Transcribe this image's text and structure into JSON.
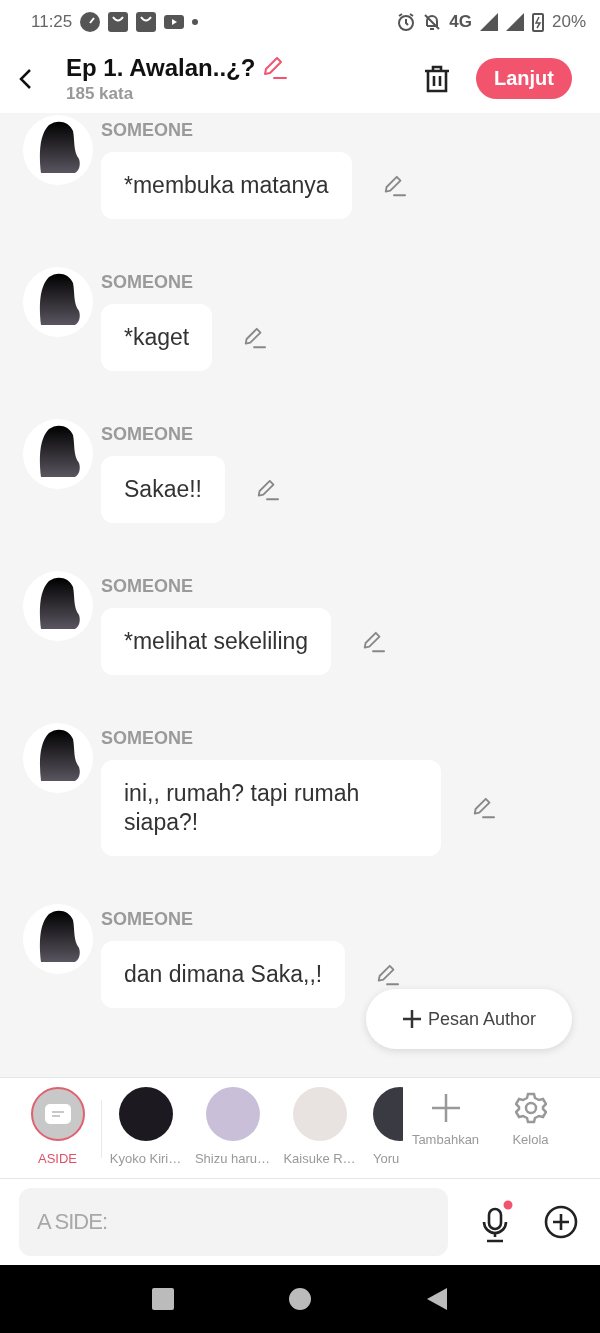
{
  "status_bar": {
    "time": "11:25",
    "network": "4G",
    "battery": "20%"
  },
  "header": {
    "title": "Ep 1. Awalan..¿?",
    "subtitle": "185 kata",
    "next_button": "Lanjut"
  },
  "messages": [
    {
      "speaker": "SOMEONE",
      "text": "*membuka matanya"
    },
    {
      "speaker": "SOMEONE",
      "text": "*kaget"
    },
    {
      "speaker": "SOMEONE",
      "text": "Sakae!!"
    },
    {
      "speaker": "SOMEONE",
      "text": "*melihat sekeliling"
    },
    {
      "speaker": "SOMEONE",
      "text": "ini,, rumah? tapi rumah siapa?!"
    },
    {
      "speaker": "SOMEONE",
      "text": "dan dimana Saka,,!"
    }
  ],
  "author_button": {
    "label": "Pesan Author"
  },
  "cast": {
    "characters": [
      {
        "kind": "aside",
        "label": "ASIDE",
        "selected": true
      },
      {
        "kind": "character",
        "label": "Kyoko Kiri…",
        "selected": false
      },
      {
        "kind": "character",
        "label": "Shizu haru…",
        "selected": false
      },
      {
        "kind": "character",
        "label": "Kaisuke R…",
        "selected": false
      },
      {
        "kind": "character",
        "label": "Yoru",
        "selected": false
      }
    ],
    "actions": [
      {
        "kind": "add",
        "label": "Tambahkan"
      },
      {
        "kind": "manage",
        "label": "Kelola"
      }
    ]
  },
  "composer": {
    "placeholder": "A SIDE:"
  }
}
